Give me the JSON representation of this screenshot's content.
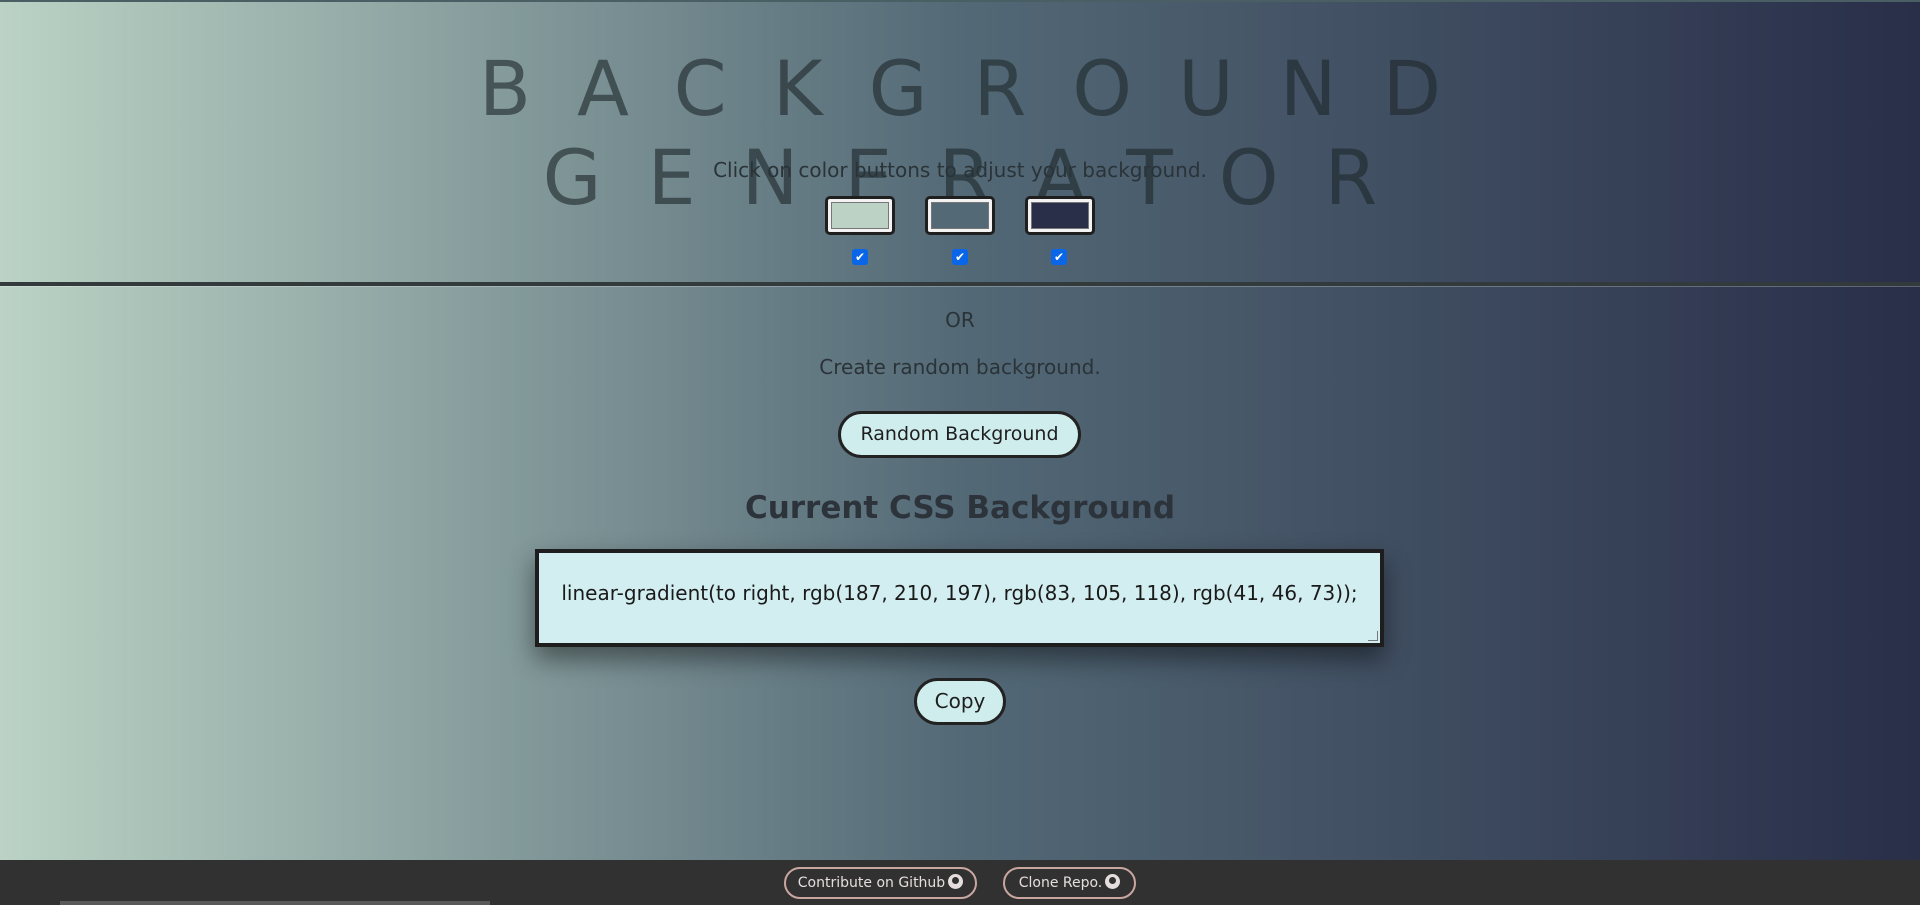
{
  "app": {
    "title": "BACKGROUND GENERATOR",
    "instructions": "Click on color buttons to adjust your background."
  },
  "colors": {
    "swatches": [
      {
        "value": "#bbd2c5",
        "enabled": true
      },
      {
        "value": "#536976",
        "enabled": true
      },
      {
        "value": "#292e49",
        "enabled": true
      }
    ]
  },
  "random": {
    "or_label": "OR",
    "prompt": "Create random background.",
    "button_label": "Random Background"
  },
  "output": {
    "heading": "Current CSS Background",
    "css_value": "linear-gradient(to right, rgb(187, 210, 197), rgb(83, 105, 118), rgb(41, 46, 73));",
    "copy_label": "Copy"
  },
  "footer": {
    "github_label": "Contribute on Github",
    "clone_label": "Clone Repo.",
    "icon": "github-icon"
  },
  "theme": {
    "button_bg": "#d0edee",
    "footer_bg": "#313131",
    "checkbox_accent": "#0a66e8"
  }
}
